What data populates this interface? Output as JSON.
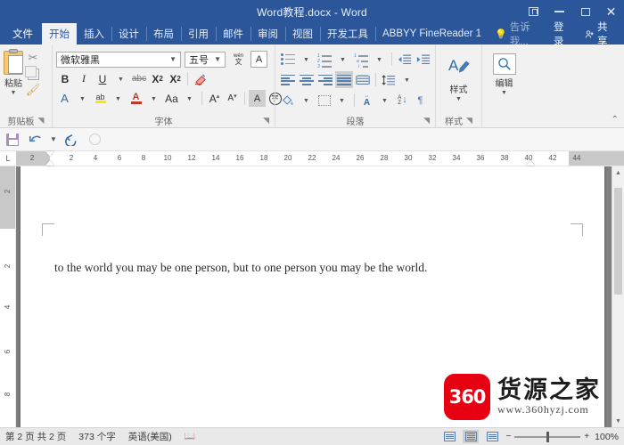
{
  "titlebar": {
    "title": "Word教程.docx - Word",
    "window_controls": [
      {
        "name": "ribbon-display-options",
        "label": ""
      },
      {
        "name": "minimize",
        "label": ""
      },
      {
        "name": "maximize",
        "label": ""
      },
      {
        "name": "close",
        "label": "✕"
      }
    ]
  },
  "tabs": {
    "file": "文件",
    "items": [
      {
        "label": "开始",
        "active": true
      },
      {
        "label": "插入",
        "active": false
      },
      {
        "label": "设计",
        "active": false
      },
      {
        "label": "布局",
        "active": false
      },
      {
        "label": "引用",
        "active": false
      },
      {
        "label": "邮件",
        "active": false
      },
      {
        "label": "审阅",
        "active": false
      },
      {
        "label": "视图",
        "active": false
      },
      {
        "label": "开发工具",
        "active": false
      },
      {
        "label": "ABBYY FineReader 1",
        "active": false
      }
    ],
    "tell_me": "告诉我...",
    "sign_in": "登录",
    "share": "共享"
  },
  "ribbon": {
    "clipboard": {
      "group_label": "剪贴板",
      "paste_label": "粘贴",
      "cut_label": "剪切",
      "copy_label": "复制",
      "format_painter_label": "格式刷"
    },
    "font": {
      "group_label": "字体",
      "font_name": "微软雅黑",
      "font_size": "五号",
      "bold": "B",
      "italic": "I",
      "underline": "U",
      "strikethrough": "abc",
      "subscript": "X₂",
      "superscript": "X²",
      "text_effects": "A",
      "highlight": "ab",
      "font_color": "A",
      "change_case": "Aa",
      "grow_font": "A",
      "shrink_font": "A",
      "char_shading": "A",
      "char_border": "字",
      "phonetic_guide": "wén文",
      "clear_formatting": "clear"
    },
    "paragraph": {
      "group_label": "段落",
      "bullets": "bullets",
      "numbering": "numbering",
      "multilevel": "multilevel",
      "decrease_indent": "decrease-indent",
      "increase_indent": "increase-indent",
      "align_left": "align-left",
      "align_center": "align-center",
      "align_right": "align-right",
      "justify": "justify",
      "distribute": "distribute",
      "line_spacing": "line-spacing",
      "shading": "shading",
      "borders": "borders",
      "asian_layout": "asian-layout",
      "sort": "sort",
      "show_marks": "show-marks"
    },
    "styles": {
      "group_label": "样式",
      "button_label": "样式"
    },
    "editing": {
      "group_label": "",
      "button_label": "编辑"
    },
    "collapse": "⌃"
  },
  "quick_access": {
    "save": "save-icon",
    "undo": "undo-icon",
    "redo": "redo-icon",
    "customize": "customize-icon"
  },
  "ruler": {
    "corner_label": "L",
    "left_start_label": "2",
    "ticks": [
      "2",
      "4",
      "6",
      "8",
      "10",
      "12",
      "14",
      "16",
      "18",
      "20",
      "22",
      "24",
      "26",
      "28",
      "30",
      "32",
      "34",
      "36",
      "38",
      "40",
      "42",
      "44"
    ],
    "vertical_ticks": [
      "2",
      "2",
      "4",
      "6",
      "8"
    ]
  },
  "document": {
    "body_text": "to the world you may be one person, but to one person you may be the world."
  },
  "watermark": {
    "logo_text": "360",
    "brand": "货源之家",
    "url": "www.360hyzj.com",
    "logo_color": "#e60012"
  },
  "statusbar": {
    "page_info": "第 2 页  共 2 页",
    "word_count": "373 个字",
    "language": "英语(美国)",
    "proofing": "proofing-icon",
    "view_buttons": [
      "read-mode",
      "print-layout",
      "web-layout"
    ],
    "zoom_level": "100%",
    "zoom_out": "−",
    "zoom_in": "+"
  },
  "colors": {
    "brand_blue": "#2b579a",
    "ribbon_bg": "#f1f1f1",
    "accent_icon": "#4a7ebb"
  }
}
